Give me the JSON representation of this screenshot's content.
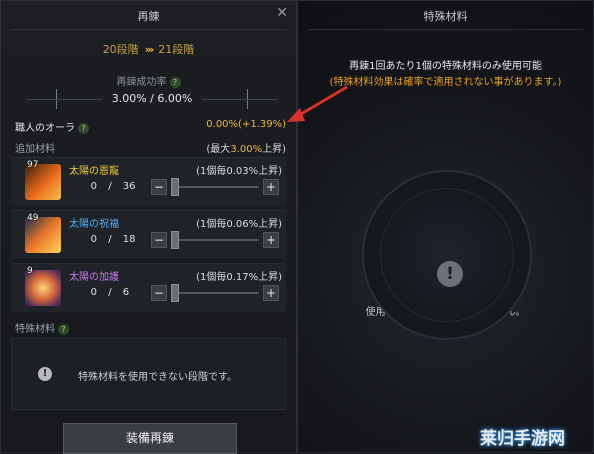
{
  "left_panel": {
    "title": "再錬",
    "close": "✕",
    "stage_from": "20段階",
    "stage_arrows": "›››",
    "stage_to": "21段階",
    "rate_label": "再錬成功率",
    "rate_value": "3.00% / 6.00%",
    "aura_label": "職人のオーラ",
    "aura_value": "0.00%(+1.39%)",
    "extra_materials_label": "追加材料",
    "max_prefix": "(最大",
    "max_value": "3.00%",
    "max_suffix": "上昇)",
    "materials": [
      {
        "count": "97",
        "name": "太陽の恩寵",
        "name_color": "#f0d03a",
        "per": "(1個毎0.03%上昇)",
        "qty": "0",
        "slash": "/",
        "max": "36",
        "icon": "sun-grace-icon"
      },
      {
        "count": "49",
        "name": "太陽の祝福",
        "name_color": "#4fb0ff",
        "per": "(1個毎0.06%上昇)",
        "qty": "0",
        "slash": "/",
        "max": "18",
        "icon": "sun-blessing-icon"
      },
      {
        "count": "9",
        "name": "太陽の加護",
        "name_color": "#c77bf0",
        "per": "(1個毎0.17%上昇)",
        "qty": "0",
        "slash": "/",
        "max": "6",
        "icon": "sun-protection-icon"
      }
    ],
    "special_label": "特殊材料",
    "special_msg": "特殊材料を使用できない段階です。",
    "equip_button": "装備再錬",
    "minus": "−",
    "plus": "+",
    "qmark": "?",
    "excl": "!"
  },
  "right_panel": {
    "title": "特殊材料",
    "notice_line1": "再錬1回あたり1個の特殊材料のみ使用可能",
    "notice_line2": "(特殊材料効果は確率で適用されない事があります。)",
    "empty_msg": "使用可能な特殊材料がありません。",
    "excl": "!"
  },
  "watermark": "莱归手游网",
  "colors": {
    "accent_gold": "#e8b640",
    "annotation_red": "#d8312a"
  }
}
